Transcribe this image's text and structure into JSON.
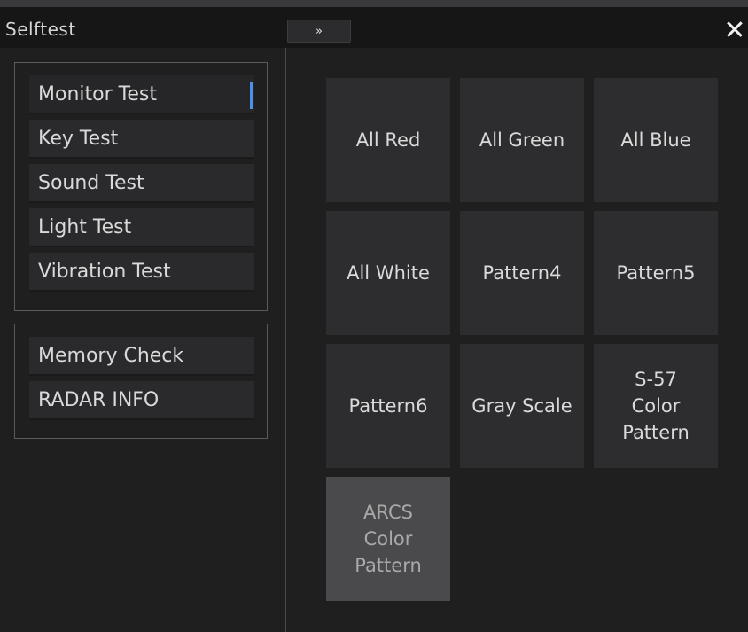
{
  "window": {
    "title": "Selftest",
    "expand_label": "»",
    "close_label": "✕"
  },
  "sidebar": {
    "group1": [
      {
        "label": "Monitor Test",
        "selected": true
      },
      {
        "label": "Key Test"
      },
      {
        "label": "Sound Test"
      },
      {
        "label": "Light Test"
      },
      {
        "label": "Vibration Test"
      }
    ],
    "group2": [
      {
        "label": "Memory Check"
      },
      {
        "label": "RADAR INFO"
      }
    ]
  },
  "tiles": [
    {
      "label": "All Red"
    },
    {
      "label": "All Green"
    },
    {
      "label": "All Blue"
    },
    {
      "label": "All White"
    },
    {
      "label": "Pattern4"
    },
    {
      "label": "Pattern5"
    },
    {
      "label": "Pattern6"
    },
    {
      "label": "Gray Scale"
    },
    {
      "label": "S-57\nColor\nPattern"
    },
    {
      "label": "ARCS\nColor\nPattern",
      "active": true
    }
  ],
  "colors": {
    "background": "#1f1f20",
    "tile": "#2d2d2f",
    "tile_active": "#4a4a4c",
    "selection_indicator": "#4d8fe8"
  }
}
